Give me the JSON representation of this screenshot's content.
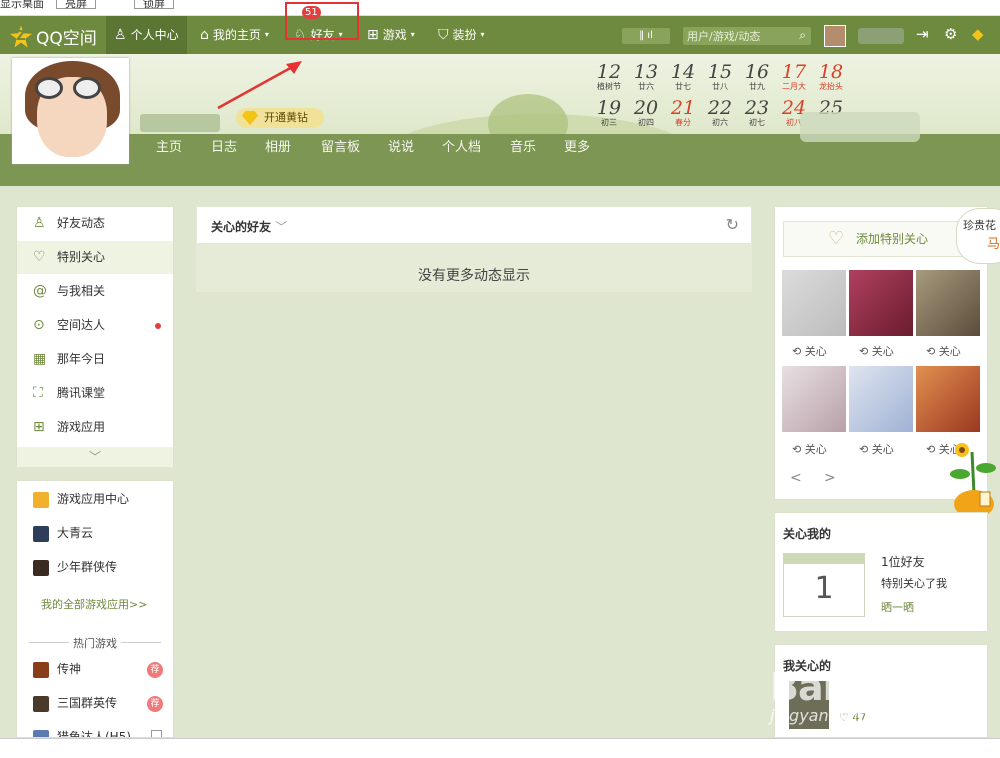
{
  "topbar": {
    "left_text": "显示桌面",
    "btn1": "亮屏",
    "btn2": "锁屏"
  },
  "nav": {
    "logo_text": "QQ空间",
    "logo_letter": "Z",
    "items": [
      "个人中心",
      "我的主页",
      "好友",
      "游戏",
      "装扮"
    ],
    "friend_badge": "51",
    "toggle_label": "‖ ıl",
    "search_placeholder": "用户/游戏/动态"
  },
  "profile": {
    "vip_label": "开通黄钻"
  },
  "calendar": {
    "row1": [
      {
        "n": "12",
        "l": "植树节",
        "red": false
      },
      {
        "n": "13",
        "l": "廿六",
        "red": false
      },
      {
        "n": "14",
        "l": "廿七",
        "red": false
      },
      {
        "n": "15",
        "l": "廿八",
        "red": false
      },
      {
        "n": "16",
        "l": "廿九",
        "red": false
      },
      {
        "n": "17",
        "l": "二月大",
        "red": true
      },
      {
        "n": "18",
        "l": "龙抬头",
        "red": true
      }
    ],
    "row2": [
      {
        "n": "19",
        "l": "初三",
        "red": false
      },
      {
        "n": "20",
        "l": "初四",
        "red": false
      },
      {
        "n": "21",
        "l": "春分",
        "red": true
      },
      {
        "n": "22",
        "l": "初六",
        "red": false
      },
      {
        "n": "23",
        "l": "初七",
        "red": false
      },
      {
        "n": "24",
        "l": "初八",
        "red": true
      },
      {
        "n": "25",
        "l": "",
        "red": false
      }
    ]
  },
  "tabs": [
    "主页",
    "日志",
    "相册",
    "留言板",
    "说说",
    "个人档",
    "音乐",
    "更多"
  ],
  "leftnav": {
    "items": [
      "好友动态",
      "特别关心",
      "与我相关",
      "空间达人",
      "那年今日",
      "腾讯课堂",
      "游戏应用"
    ],
    "more": "﹀"
  },
  "games": {
    "center": "游戏应用中心",
    "items": [
      "大青云",
      "少年群侠传"
    ],
    "all_link": "我的全部游戏应用>>",
    "hot_title": "热门游戏",
    "hot_items": [
      "传神",
      "三国群英传",
      "猎龟达人(H5)"
    ],
    "hot_badge": "荐"
  },
  "feed": {
    "title": "关心的好友",
    "empty": "没有更多动态显示"
  },
  "right": {
    "add_special": "添加特别关心",
    "bubble_1": "珍贵花",
    "bubble_2": "马上",
    "care_label": "关心",
    "prev": "<",
    "next": ">"
  },
  "cares_me": {
    "title": "关心我的",
    "day": "1",
    "line1": "1位好友",
    "line2": "特别关心了我",
    "share": "晒一晒"
  },
  "i_care": {
    "title": "我关心的",
    "count": "47"
  },
  "watermark": {
    "main": "Baidu经验",
    "sub": "jingyan.baidu.com"
  },
  "colors": {
    "nav_green": "#6e8a3e",
    "accent_red": "#e53333",
    "vip_gold": "#f3c318"
  }
}
